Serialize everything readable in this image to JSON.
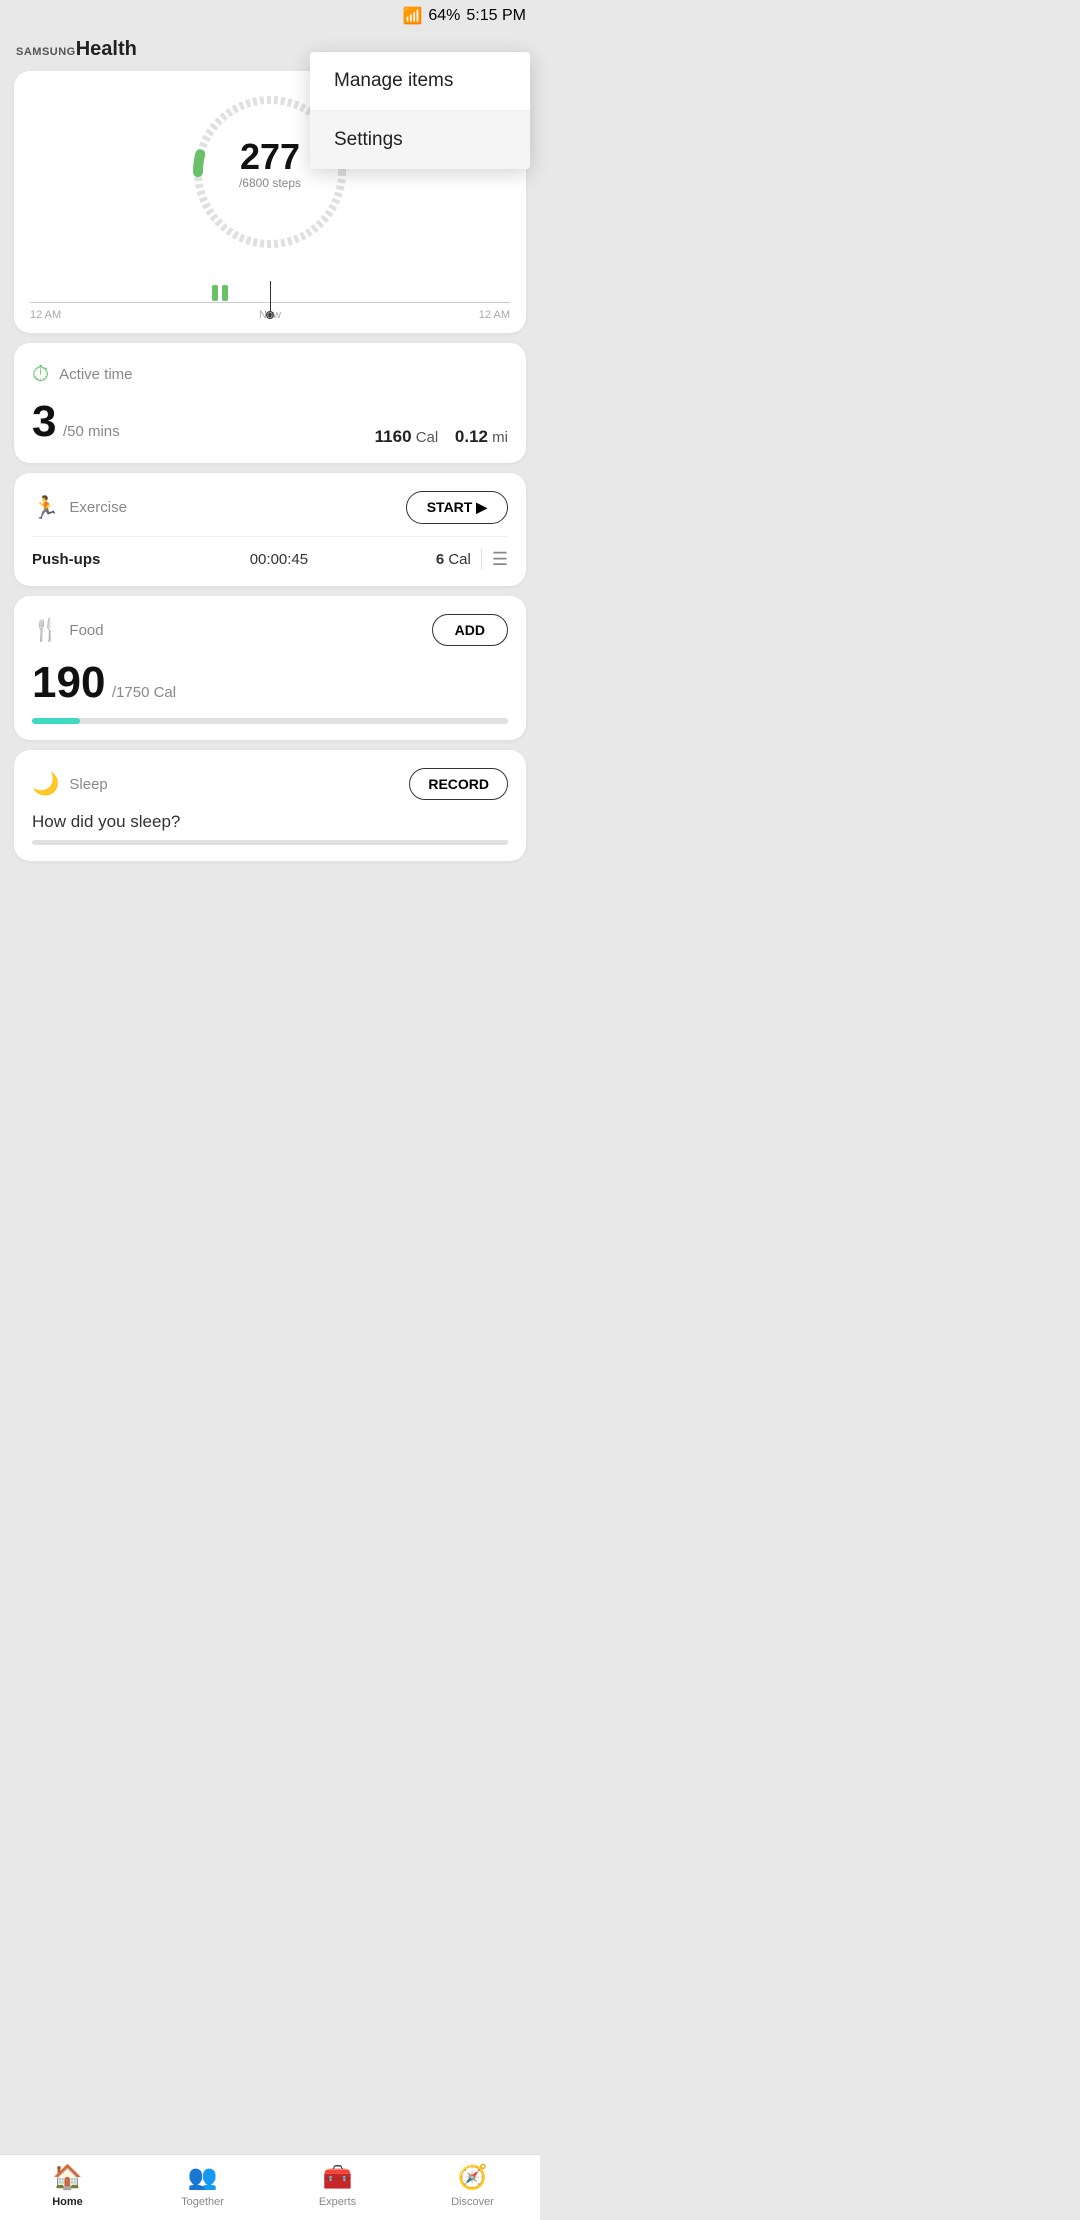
{
  "statusBar": {
    "wifi": "wifi",
    "signal": "signal",
    "battery": "64%",
    "time": "5:15 PM"
  },
  "header": {
    "logoSamsung": "SAMSUNG",
    "logoHealth": "Health"
  },
  "dropdown": {
    "items": [
      {
        "id": "manage-items",
        "label": "Manage items",
        "active": false
      },
      {
        "id": "settings",
        "label": "Settings",
        "active": true
      }
    ]
  },
  "steps": {
    "current": "277",
    "goal": "/6800 steps",
    "timelineLabels": {
      "left": "12 AM",
      "center": "Now",
      "right": "12 AM"
    },
    "progressPercent": 4.07
  },
  "activeTime": {
    "title": "Active time",
    "current": "3",
    "unit": "/50 mins",
    "calories": "1160",
    "caloriesUnit": "Cal",
    "distance": "0.12",
    "distanceUnit": "mi"
  },
  "exercise": {
    "title": "Exercise",
    "startLabel": "START ▶",
    "item": {
      "name": "Push-ups",
      "time": "00:00:45",
      "calories": "6",
      "caloriesUnit": "Cal"
    }
  },
  "food": {
    "title": "Food",
    "addLabel": "ADD",
    "current": "190",
    "goal": "/1750 Cal",
    "progressPercent": 10
  },
  "sleep": {
    "title": "Sleep",
    "recordLabel": "RECORD",
    "question": "How did you sleep?"
  },
  "bottomNav": {
    "items": [
      {
        "id": "home",
        "label": "Home",
        "icon": "🏠",
        "active": true
      },
      {
        "id": "together",
        "label": "Together",
        "icon": "👥",
        "active": false
      },
      {
        "id": "experts",
        "label": "Experts",
        "icon": "🧰",
        "active": false
      },
      {
        "id": "discover",
        "label": "Discover",
        "icon": "🧭",
        "active": false
      }
    ]
  }
}
